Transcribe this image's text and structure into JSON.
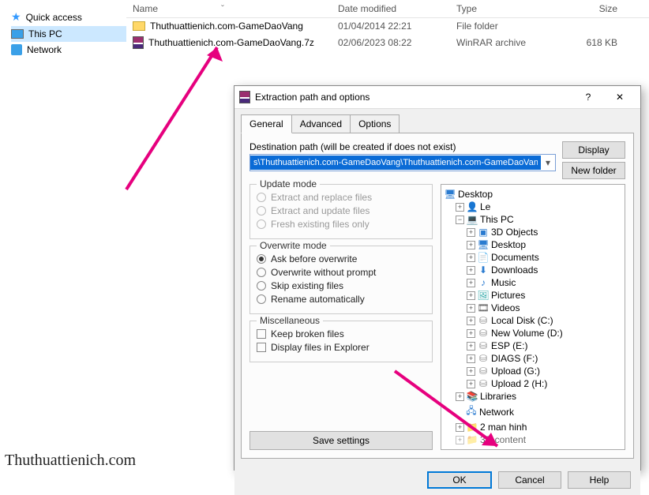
{
  "explorer": {
    "sidebar": {
      "quick_access": "Quick access",
      "this_pc": "This PC",
      "network": "Network"
    },
    "columns": {
      "name": "Name",
      "date": "Date modified",
      "type": "Type",
      "size": "Size"
    },
    "rows": [
      {
        "name": "Thuthuattienich.com-GameDaoVang",
        "date": "01/04/2014 22:21",
        "type": "File folder",
        "size": ""
      },
      {
        "name": "Thuthuattienich.com-GameDaoVang.7z",
        "date": "02/06/2023 08:22",
        "type": "WinRAR archive",
        "size": "618 KB"
      }
    ]
  },
  "dialog": {
    "title": "Extraction path and options",
    "help_glyph": "?",
    "close_glyph": "✕",
    "tabs": {
      "general": "General",
      "advanced": "Advanced",
      "options": "Options"
    },
    "path_label": "Destination path (will be created if does not exist)",
    "path_value": "s\\Thuthuattienich.com-GameDaoVang\\Thuthuattienich.com-GameDaoVang",
    "display_btn": "Display",
    "newfolder_btn": "New folder",
    "groups": {
      "update": {
        "title": "Update mode",
        "o1": "Extract and replace files",
        "o2": "Extract and update files",
        "o3": "Fresh existing files only"
      },
      "overwrite": {
        "title": "Overwrite mode",
        "o1": "Ask before overwrite",
        "o2": "Overwrite without prompt",
        "o3": "Skip existing files",
        "o4": "Rename automatically"
      },
      "misc": {
        "title": "Miscellaneous",
        "c1": "Keep broken files",
        "c2": "Display files in Explorer"
      }
    },
    "save_settings": "Save settings",
    "tree": {
      "desktop": "Desktop",
      "le": "Le",
      "this_pc": "This PC",
      "objects3d": "3D Objects",
      "desktop2": "Desktop",
      "documents": "Documents",
      "downloads": "Downloads",
      "music": "Music",
      "pictures": "Pictures",
      "videos": "Videos",
      "localc": "Local Disk (C:)",
      "newvol": "New Volume (D:)",
      "esp": "ESP (E:)",
      "diags": "DIAGS (F:)",
      "uploadg": "Upload (G:)",
      "upload2h": "Upload 2 (H:)",
      "libraries": "Libraries",
      "network": "Network",
      "twomh": "2 man hinh",
      "cut": "3D content"
    },
    "buttons": {
      "ok": "OK",
      "cancel": "Cancel",
      "help": "Help"
    }
  },
  "watermark": "Thuthuattienich.com"
}
